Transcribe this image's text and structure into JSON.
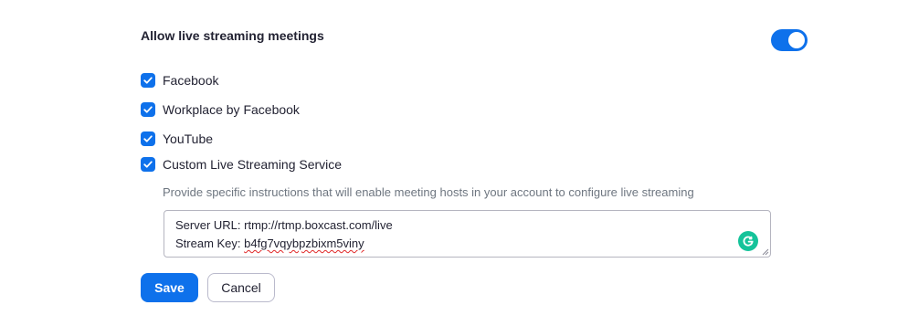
{
  "setting": {
    "title": "Allow live streaming meetings",
    "enabled": true
  },
  "options": [
    {
      "label": "Facebook",
      "checked": true
    },
    {
      "label": "Workplace by Facebook",
      "checked": true
    },
    {
      "label": "YouTube",
      "checked": true
    },
    {
      "label": "Custom Live Streaming Service",
      "checked": true
    }
  ],
  "custom_service": {
    "helper_text": "Provide specific instructions that will enable meeting hosts in your account to configure live streaming",
    "instructions_line1": "Server URL: rtmp://rtmp.boxcast.com/live",
    "instructions_line2_label": "Stream Key: ",
    "instructions_line2_value": "b4fg7vqybpzbixm5viny"
  },
  "actions": {
    "save_label": "Save",
    "cancel_label": "Cancel"
  },
  "colors": {
    "accent": "#0e71eb",
    "grammarly": "#15c39a",
    "spell_error": "#e02828"
  },
  "icons": {
    "check": "check-icon",
    "grammarly": "grammarly-icon",
    "resize": "resize-handle-icon"
  }
}
